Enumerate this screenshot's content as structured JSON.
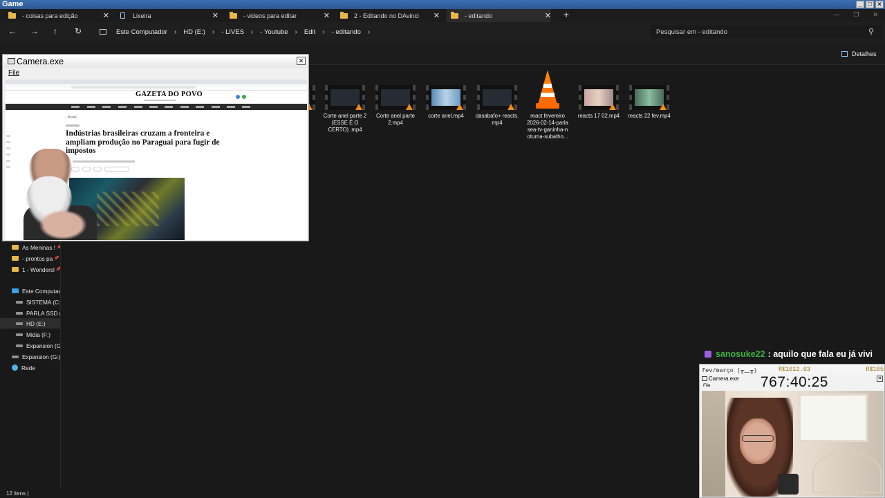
{
  "window": {
    "title": "Game"
  },
  "tabs": [
    {
      "label": "- coisas para edição",
      "icon": "folder-icon"
    },
    {
      "label": "Lixeira",
      "icon": "recycle-bin-icon"
    },
    {
      "label": "- videos para editar",
      "icon": "folder-icon"
    },
    {
      "label": "2 - Editando no DAvinci",
      "icon": "folder-icon"
    },
    {
      "label": "- editando",
      "icon": "folder-icon",
      "active": true
    }
  ],
  "nav": {
    "breadcrumbs": [
      "Este Computador",
      "HD (E:)",
      "- LIVES",
      "- Youtube",
      "Edit",
      "- editando"
    ],
    "search_placeholder": "Pesquisar em - editando"
  },
  "toolbar": {
    "details_label": "Detalhes"
  },
  "sidebar": {
    "items": [
      {
        "label": "As Meninas !",
        "type": "folder",
        "pinned": true
      },
      {
        "label": "- prontos pa",
        "type": "folder",
        "pinned": true
      },
      {
        "label": "1 - Wondersl",
        "type": "folder",
        "pinned": true
      },
      {
        "label": "Este Computad",
        "type": "pc"
      },
      {
        "label": "SISTEMA (C:)",
        "type": "drive"
      },
      {
        "label": "PARLA SSD (D",
        "type": "drive"
      },
      {
        "label": "HD (E:)",
        "type": "drive",
        "selected": true
      },
      {
        "label": "Midia (F:)",
        "type": "drive"
      },
      {
        "label": "Expansion (G:)",
        "type": "drive"
      },
      {
        "label": "Expansion (G:)",
        "type": "drive"
      },
      {
        "label": "Rede",
        "type": "network"
      }
    ]
  },
  "files": [
    {
      "name": "Corte anel parte 2 (ESSE É O CERTO) .mp4",
      "kind": "video"
    },
    {
      "name": "Corte anel parte 2.mp4",
      "kind": "video"
    },
    {
      "name": "corte anel.mp4",
      "kind": "video-light"
    },
    {
      "name": "dasabafo+ reacts. mp4",
      "kind": "video"
    },
    {
      "name": "react fevereiro 2026-02-14-parla sea-tv-ganinha-n oturna-subatho...",
      "kind": "vlc"
    },
    {
      "name": "reacts 17 02.mp4",
      "kind": "video-pink"
    },
    {
      "name": "reacts 22 fev.mp4",
      "kind": "video-green"
    }
  ],
  "status": {
    "count": "12 itens"
  },
  "camera_window": {
    "title": "Camera.exe",
    "menu_file": "File",
    "article": {
      "logo": "GAZETA DO POVO",
      "crumb": "‹ Brasil",
      "headline": "Indústrias brasileiras cruzam a fronteira e ampliam produção no Paraguai para fugir de impostos"
    }
  },
  "chat": {
    "user": "sanosuke22",
    "message": ": aquilo que fala eu já vivi"
  },
  "camera2": {
    "label_left": "fev/março (╥﹏╥)",
    "label_mid": "R$1612.63",
    "label_right": "R$165",
    "title": "Camera.exe",
    "menu_file": "File",
    "timer": "767:40:25"
  },
  "colors": {
    "folder": "#e8b74a",
    "chat_user": "#3cb043",
    "vlc": "#ff7a00",
    "title_bar": "#2c5896"
  }
}
